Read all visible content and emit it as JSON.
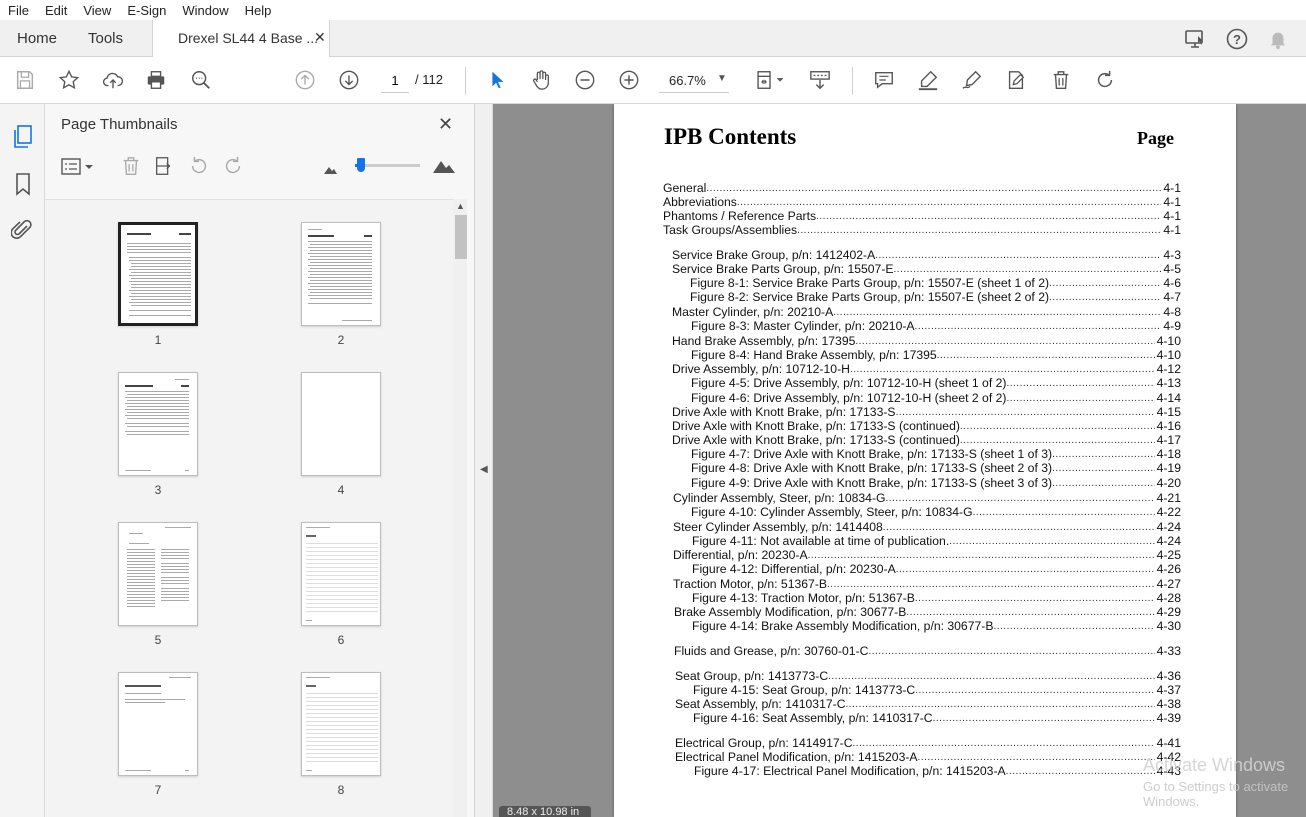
{
  "menu": [
    "File",
    "Edit",
    "View",
    "E-Sign",
    "Window",
    "Help"
  ],
  "tabs": {
    "home": "Home",
    "tools": "Tools",
    "document": "Drexel SL44 4 Base ..."
  },
  "toolbar": {
    "page_current": "1",
    "page_total": "/ 112",
    "zoom": "66.7%"
  },
  "panel": {
    "title": "Page Thumbnails",
    "thumbnails": [
      {
        "label": "1",
        "selected": true
      },
      {
        "label": "2",
        "selected": false
      },
      {
        "label": "3",
        "selected": false
      },
      {
        "label": "4",
        "selected": false
      },
      {
        "label": "5",
        "selected": false
      },
      {
        "label": "6",
        "selected": false
      },
      {
        "label": "7",
        "selected": false
      },
      {
        "label": "8",
        "selected": false
      }
    ]
  },
  "document": {
    "heading": "IPB Contents",
    "page_column": "Page",
    "page_size": "8.48 x 10.98 in",
    "toc": [
      {
        "text": "General",
        "page": "4-1"
      },
      {
        "text": "Abbreviations",
        "page": "4-1"
      },
      {
        "text": "Phantoms / Reference Parts",
        "page": "4-1"
      },
      {
        "text": "Task Groups/Assemblies",
        "page": "4-1"
      },
      {
        "text": "Service Brake Group, p/n: 1412402-A",
        "page": "4-3"
      },
      {
        "text": "Service Brake Parts Group, p/n: 15507-E",
        "page": "4-5"
      },
      {
        "text": "Figure 8-1: Service Brake Parts Group, p/n: 15507-E (sheet 1 of 2)",
        "page": "4-6"
      },
      {
        "text": "Figure 8-2: Service Brake Parts Group, p/n: 15507-E (sheet 2 of 2)",
        "page": "4-7"
      },
      {
        "text": "Master Cylinder, p/n: 20210-A",
        "page": "4-8"
      },
      {
        "text": "Figure 8-3: Master Cylinder, p/n: 20210-A",
        "page": "4-9"
      },
      {
        "text": "Hand Brake Assembly, p/n: 17395",
        "page": "4-10"
      },
      {
        "text": "Figure 8-4: Hand Brake Assembly, p/n: 17395",
        "page": "4-10"
      },
      {
        "text": "Drive Assembly, p/n: 10712-10-H",
        "page": "4-12"
      },
      {
        "text": "Figure 4-5: Drive Assembly, p/n: 10712-10-H (sheet 1 of 2)",
        "page": "4-13"
      },
      {
        "text": "Figure 4-6: Drive Assembly, p/n: 10712-10-H (sheet 2 of 2)",
        "page": "4-14"
      },
      {
        "text": "Drive Axle with Knott Brake, p/n: 17133-S",
        "page": "4-15"
      },
      {
        "text": "Drive Axle with Knott Brake, p/n: 17133-S (continued)",
        "page": "4-16"
      },
      {
        "text": "Drive Axle with Knott Brake, p/n: 17133-S (continued)",
        "page": "4-17"
      },
      {
        "text": "Figure 4-7: Drive Axle with Knott Brake, p/n: 17133-S (sheet 1 of 3)",
        "page": "4-18"
      },
      {
        "text": "Figure 4-8: Drive Axle with Knott Brake, p/n: 17133-S (sheet 2 of 3)",
        "page": "4-19"
      },
      {
        "text": "Figure 4-9: Drive Axle with Knott Brake, p/n: 17133-S (sheet 3 of 3)",
        "page": "4-20"
      },
      {
        "text": "Cylinder Assembly, Steer, p/n: 10834-G",
        "page": "4-21"
      },
      {
        "text": "Figure 4-10: Cylinder Assembly, Steer, p/n: 10834-G",
        "page": "4-22"
      },
      {
        "text": "Steer Cylinder Assembly, p/n: 1414408",
        "page": "4-24"
      },
      {
        "text": "Figure 4-11: Not available at time of publication.",
        "page": "4-24"
      },
      {
        "text": "Differential, p/n: 20230-A",
        "page": "4-25"
      },
      {
        "text": "Figure 4-12: Differential, p/n: 20230-A",
        "page": "4-26"
      },
      {
        "text": "Traction Motor, p/n: 51367-B",
        "page": "4-27"
      },
      {
        "text": "Figure 4-13: Traction Motor, p/n: 51367-B",
        "page": "4-28"
      },
      {
        "text": "Brake Assembly Modification, p/n: 30677-B",
        "page": "4-29"
      },
      {
        "text": "Figure 4-14: Brake Assembly Modification, p/n: 30677-B",
        "page": "4-30"
      },
      {
        "text": "Fluids and Grease, p/n: 30760-01-C",
        "page": "4-33"
      },
      {
        "text": "Seat Group, p/n: 1413773-C",
        "page": "4-36"
      },
      {
        "text": "Figure 4-15: Seat Group, p/n: 1413773-C",
        "page": "4-37"
      },
      {
        "text": "Seat Assembly, p/n: 1410317-C",
        "page": "4-38"
      },
      {
        "text": "Figure 4-16: Seat Assembly, p/n: 1410317-C",
        "page": "4-39"
      },
      {
        "text": "Electrical Group, p/n: 1414917-C",
        "page": "4-41"
      },
      {
        "text": "Electrical Panel Modification, p/n: 1415203-A",
        "page": "4-42"
      },
      {
        "text": "Figure 4-17: Electrical Panel Modification, p/n: 1415203-A",
        "page": "4-43"
      }
    ]
  },
  "watermark": {
    "line1": "Activate Windows",
    "line2": "Go to Settings to activate Windows."
  }
}
